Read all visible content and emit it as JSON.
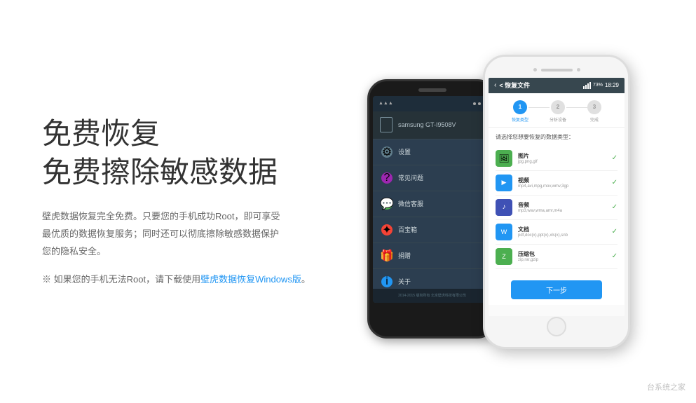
{
  "left": {
    "title_line1": "免费恢复",
    "title_line2": "免费擦除敏感数据",
    "description": "壁虎数据恢复完全免费。只要您的手机成功Root，即可享受最优质的数据恢复服务；同时还可以彻底擦除敏感数据保护您的隐私安全。",
    "note_prefix": "※ 如果您的手机无法Root，请下载使用",
    "note_link": "壁虎数据恢复Windows版",
    "note_suffix": "。"
  },
  "phone_dark": {
    "device_name": "samsung GT-I9508V",
    "menu_items": [
      {
        "icon": "gear",
        "label": "设置"
      },
      {
        "icon": "question",
        "label": "常见问题"
      },
      {
        "icon": "wechat",
        "label": "微信客服"
      },
      {
        "icon": "star",
        "label": "百宝箱"
      },
      {
        "icon": "gift",
        "label": "捐赠"
      },
      {
        "icon": "info",
        "label": "关于"
      }
    ],
    "footer": "2014-2015 版权所有 北京壁虎科技有限公司"
  },
  "phone_white": {
    "status_title": "< 恢复文件",
    "time": "18:29",
    "battery": "73%",
    "steps": [
      {
        "num": "1",
        "label": "恢复类型",
        "active": true
      },
      {
        "num": "2",
        "label": "分析设备",
        "active": false
      },
      {
        "num": "3",
        "label": "完成",
        "active": false
      }
    ],
    "content_title": "请选择您想要恢复的数据类型：",
    "file_types": [
      {
        "icon": "🖼",
        "type": "image",
        "name": "图片",
        "ext": "jpg,png,gif"
      },
      {
        "icon": "▶",
        "type": "video",
        "name": "视频",
        "ext": "mp4,avi,mpg,mov,wmv,3gp"
      },
      {
        "icon": "♪",
        "type": "audio",
        "name": "音频",
        "ext": "mp3,wav,wma,amr,m4a"
      },
      {
        "icon": "📄",
        "type": "doc",
        "name": "文档",
        "ext": "pdf,doc(x),ppt(x),xls(x),snb"
      },
      {
        "icon": "📦",
        "type": "zip",
        "name": "压缩包",
        "ext": "zip,rar,gzip"
      }
    ],
    "next_button": "下一步"
  },
  "watermark": "台系统之家"
}
